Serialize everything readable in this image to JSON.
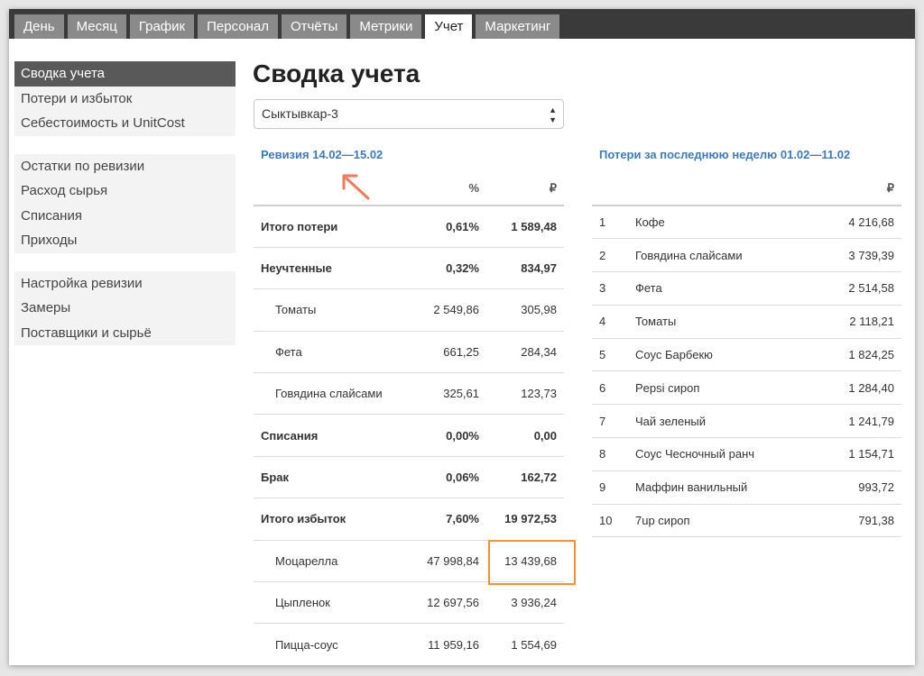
{
  "nav": {
    "tabs": [
      "День",
      "Месяц",
      "График",
      "Персонал",
      "Отчёты",
      "Метрики",
      "Учет",
      "Маркетинг"
    ],
    "active_index": 6
  },
  "sidebar": {
    "group1": [
      "Сводка учета",
      "Потери и избыток",
      "Себестоимость и UnitCost"
    ],
    "group2": [
      "Остатки по ревизии",
      "Расход сырья",
      "Списания",
      "Приходы"
    ],
    "group3": [
      "Настройка ревизии",
      "Замеры",
      "Поставщики и сырьё"
    ],
    "active_item": "Сводка учета"
  },
  "main": {
    "title": "Сводка учета",
    "location_select": "Сыктывкар-3"
  },
  "revision": {
    "title": "Ревизия 14.02—15.02",
    "col_percent": "%",
    "col_currency": "₽",
    "rows": [
      {
        "name": "Итого потери",
        "pct": "0,61%",
        "amount": "1 589,48",
        "bold": true
      },
      {
        "name": "Неучтенные",
        "pct": "0,32%",
        "amount": "834,97",
        "bold": true
      },
      {
        "name": "Томаты",
        "pct": "2 549,86",
        "amount": "305,98",
        "bold": false
      },
      {
        "name": "Фета",
        "pct": "661,25",
        "amount": "284,34",
        "bold": false
      },
      {
        "name": "Говядина слайсами",
        "pct": "325,61",
        "amount": "123,73",
        "bold": false
      },
      {
        "name": "Списания",
        "pct": "0,00%",
        "amount": "0,00",
        "bold": true
      },
      {
        "name": "Брак",
        "pct": "0,06%",
        "amount": "162,72",
        "bold": true
      },
      {
        "name": "Итого избыток",
        "pct": "7,60%",
        "amount": "19 972,53",
        "bold": true
      },
      {
        "name": "Моцарелла",
        "pct": "47 998,84",
        "amount": "13 439,68",
        "bold": false
      },
      {
        "name": "Цыпленок",
        "pct": "12 697,56",
        "amount": "3 936,24",
        "bold": false
      },
      {
        "name": "Пицца-соус",
        "pct": "11 959,16",
        "amount": "1 554,69",
        "bold": false
      }
    ]
  },
  "losses": {
    "title": "Потери за последнюю неделю 01.02—11.02",
    "col_currency": "₽",
    "rows": [
      {
        "n": "1",
        "name": "Кофе",
        "amount": "4 216,68"
      },
      {
        "n": "2",
        "name": "Говядина слайсами",
        "amount": "3 739,39"
      },
      {
        "n": "3",
        "name": "Фета",
        "amount": "2 514,58"
      },
      {
        "n": "4",
        "name": "Томаты",
        "amount": "2 118,21"
      },
      {
        "n": "5",
        "name": "Соус Барбекю",
        "amount": "1 824,25"
      },
      {
        "n": "6",
        "name": "Pepsi сироп",
        "amount": "1 284,40"
      },
      {
        "n": "7",
        "name": "Чай зеленый",
        "amount": "1 241,79"
      },
      {
        "n": "8",
        "name": "Соус Чесночный ранч",
        "amount": "1 154,71"
      },
      {
        "n": "9",
        "name": "Маффин ванильный",
        "amount": "993,72"
      },
      {
        "n": "10",
        "name": "7up сироп",
        "amount": "791,38"
      }
    ]
  },
  "colors": {
    "link": "#3d7ab8",
    "highlight": "#f0922f",
    "arrow": "#f07a5a"
  }
}
